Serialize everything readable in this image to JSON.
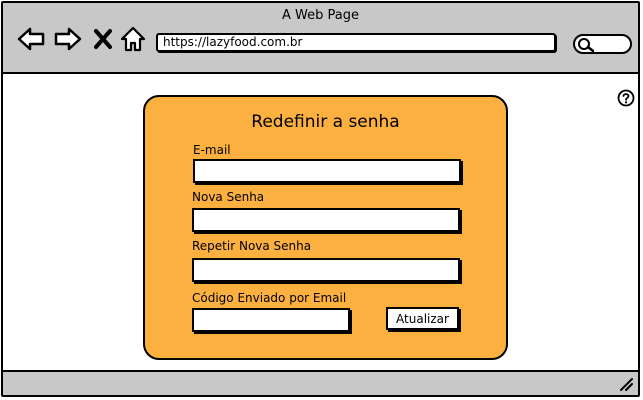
{
  "window": {
    "title": "A Web Page",
    "url": "https://lazyfood.com.br"
  },
  "icons": {
    "back": "back-arrow-icon",
    "forward": "forward-arrow-icon",
    "close": "close-x-icon",
    "home": "home-icon",
    "search": "search-icon",
    "help": "help-icon",
    "resize": "resize-grip-icon"
  },
  "colors": {
    "chrome": "#c8c8c8",
    "card": "#fbb040"
  },
  "form": {
    "title": "Redefinir a senha",
    "email_label": "E-mail",
    "email_value": "",
    "new_password_label": "Nova Senha",
    "new_password_value": "",
    "repeat_password_label": "Repetir Nova Senha",
    "repeat_password_value": "",
    "code_label": "Código Enviado por Email",
    "code_value": "",
    "submit_label": "Atualizar"
  }
}
